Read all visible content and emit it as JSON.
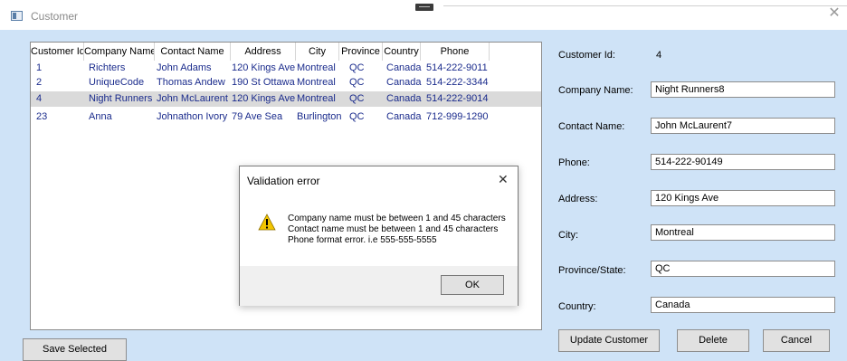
{
  "window": {
    "title": "Customer",
    "icon": "window-icon"
  },
  "grid": {
    "columns": [
      "Customer Id",
      "Company Name",
      "Contact Name",
      "Address",
      "City",
      "Province",
      "Country",
      "Phone"
    ],
    "rows": [
      [
        "1",
        "Richters",
        "John Adams",
        "120 Kings Ave",
        "Montreal",
        "QC",
        "Canada",
        "514-222-9011"
      ],
      [
        "2",
        "UniqueCode",
        "Thomas Andew",
        "190 St Ottawa",
        "Montreal",
        "QC",
        "Canada",
        "514-222-3344"
      ],
      [
        "4",
        "Night Runners",
        "John McLaurent",
        "120 Kings Ave",
        "Montreal",
        "QC",
        "Canada",
        "514-222-9014"
      ],
      [
        "23",
        "Anna",
        "Johnathon Ivory",
        "79 Ave Sea",
        "Burlington",
        "QC",
        "Canada",
        "712-999-1290"
      ]
    ],
    "selected_row": 3
  },
  "form": {
    "customer_id_label": "Customer Id:",
    "customer_id_value": "4",
    "company_label": "Company Name:",
    "company_value": "Night Runners8",
    "contact_label": "Contact Name:",
    "contact_value": "John McLaurent7",
    "phone_label": "Phone:",
    "phone_value": "514-222-90149",
    "address_label": "Address:",
    "address_value": "120 Kings Ave",
    "city_label": "City:",
    "city_value": "Montreal",
    "province_label": "Province/State:",
    "province_value": "QC",
    "country_label": "Country:",
    "country_value": "Canada"
  },
  "buttons": {
    "save_selected": "Save Selected",
    "update_customer": "Update Customer",
    "delete": "Delete",
    "cancel": "Cancel"
  },
  "dialog": {
    "title": "Validation error",
    "close": "✕",
    "icon": "warning-icon",
    "messages": [
      "Company name must be between 1 and 45 characters",
      "Contact name must be between 1 and 45 characters",
      "Phone format error. i.e 555-555-5555"
    ],
    "ok_label": "OK"
  },
  "colors": {
    "background": "#cfe3f7",
    "grid_text": "#1a2b8c",
    "selected_row": "#dadada"
  }
}
